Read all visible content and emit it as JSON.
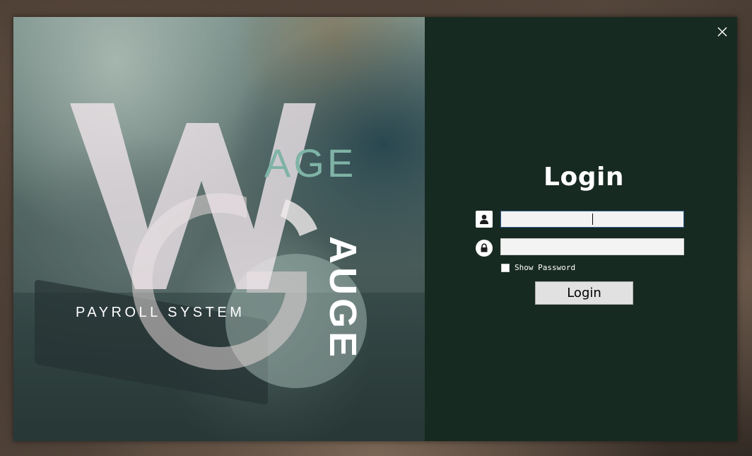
{
  "logo": {
    "letter_w": "W",
    "letter_g": "G",
    "word_age": "AGE",
    "word_auge": "AUGE",
    "tagline": "PAYROLL SYSTEM"
  },
  "login": {
    "title": "Login",
    "username_value": "",
    "password_value": "",
    "show_password_label": "Show Password",
    "show_password_checked": false,
    "button_label": "Login"
  },
  "icons": {
    "close": "close-icon",
    "user": "user-icon",
    "lock": "lock-icon"
  },
  "colors": {
    "right_panel": "#172a22",
    "logo_accent": "#7fb3a6",
    "button_bg": "#e1e1e1"
  }
}
